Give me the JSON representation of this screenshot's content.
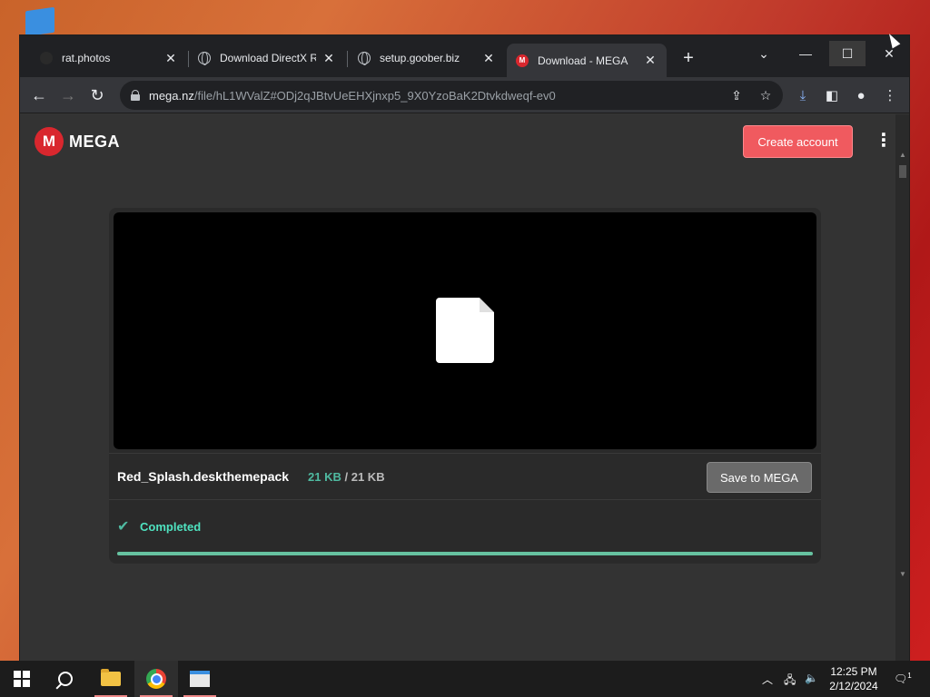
{
  "browser": {
    "tabs": [
      {
        "title": "rat.photos",
        "favicon": "dark-favicon-icon"
      },
      {
        "title": "Download DirectX Re",
        "favicon": "globe-icon"
      },
      {
        "title": "setup.goober.biz",
        "favicon": "globe-icon"
      },
      {
        "title": "Download - MEGA",
        "favicon": "mega-icon",
        "active": true
      }
    ],
    "address": {
      "host": "mega.nz",
      "path": "/file/hL1WValZ#ODj2qJBtvUeEHXjnxp5_9X0YzoBaK2Dtvkdweqf-ev0"
    }
  },
  "page": {
    "logo_letter": "M",
    "logo_text": "MEGA",
    "create_account": "Create account",
    "file": {
      "name": "Red_Splash.deskthemepack",
      "downloaded": "21 KB",
      "separator": "/",
      "total": "21 KB"
    },
    "save_button": "Save to MEGA",
    "status": "Completed",
    "progress": 1.0
  },
  "taskbar": {
    "time": "12:25 PM",
    "date": "2/12/2024",
    "notification_count": "1"
  },
  "colors": {
    "mega_red": "#d9272e",
    "create_button": "#f05a5f",
    "completed": "#4fe3c0",
    "progress": "#66c2a0"
  }
}
